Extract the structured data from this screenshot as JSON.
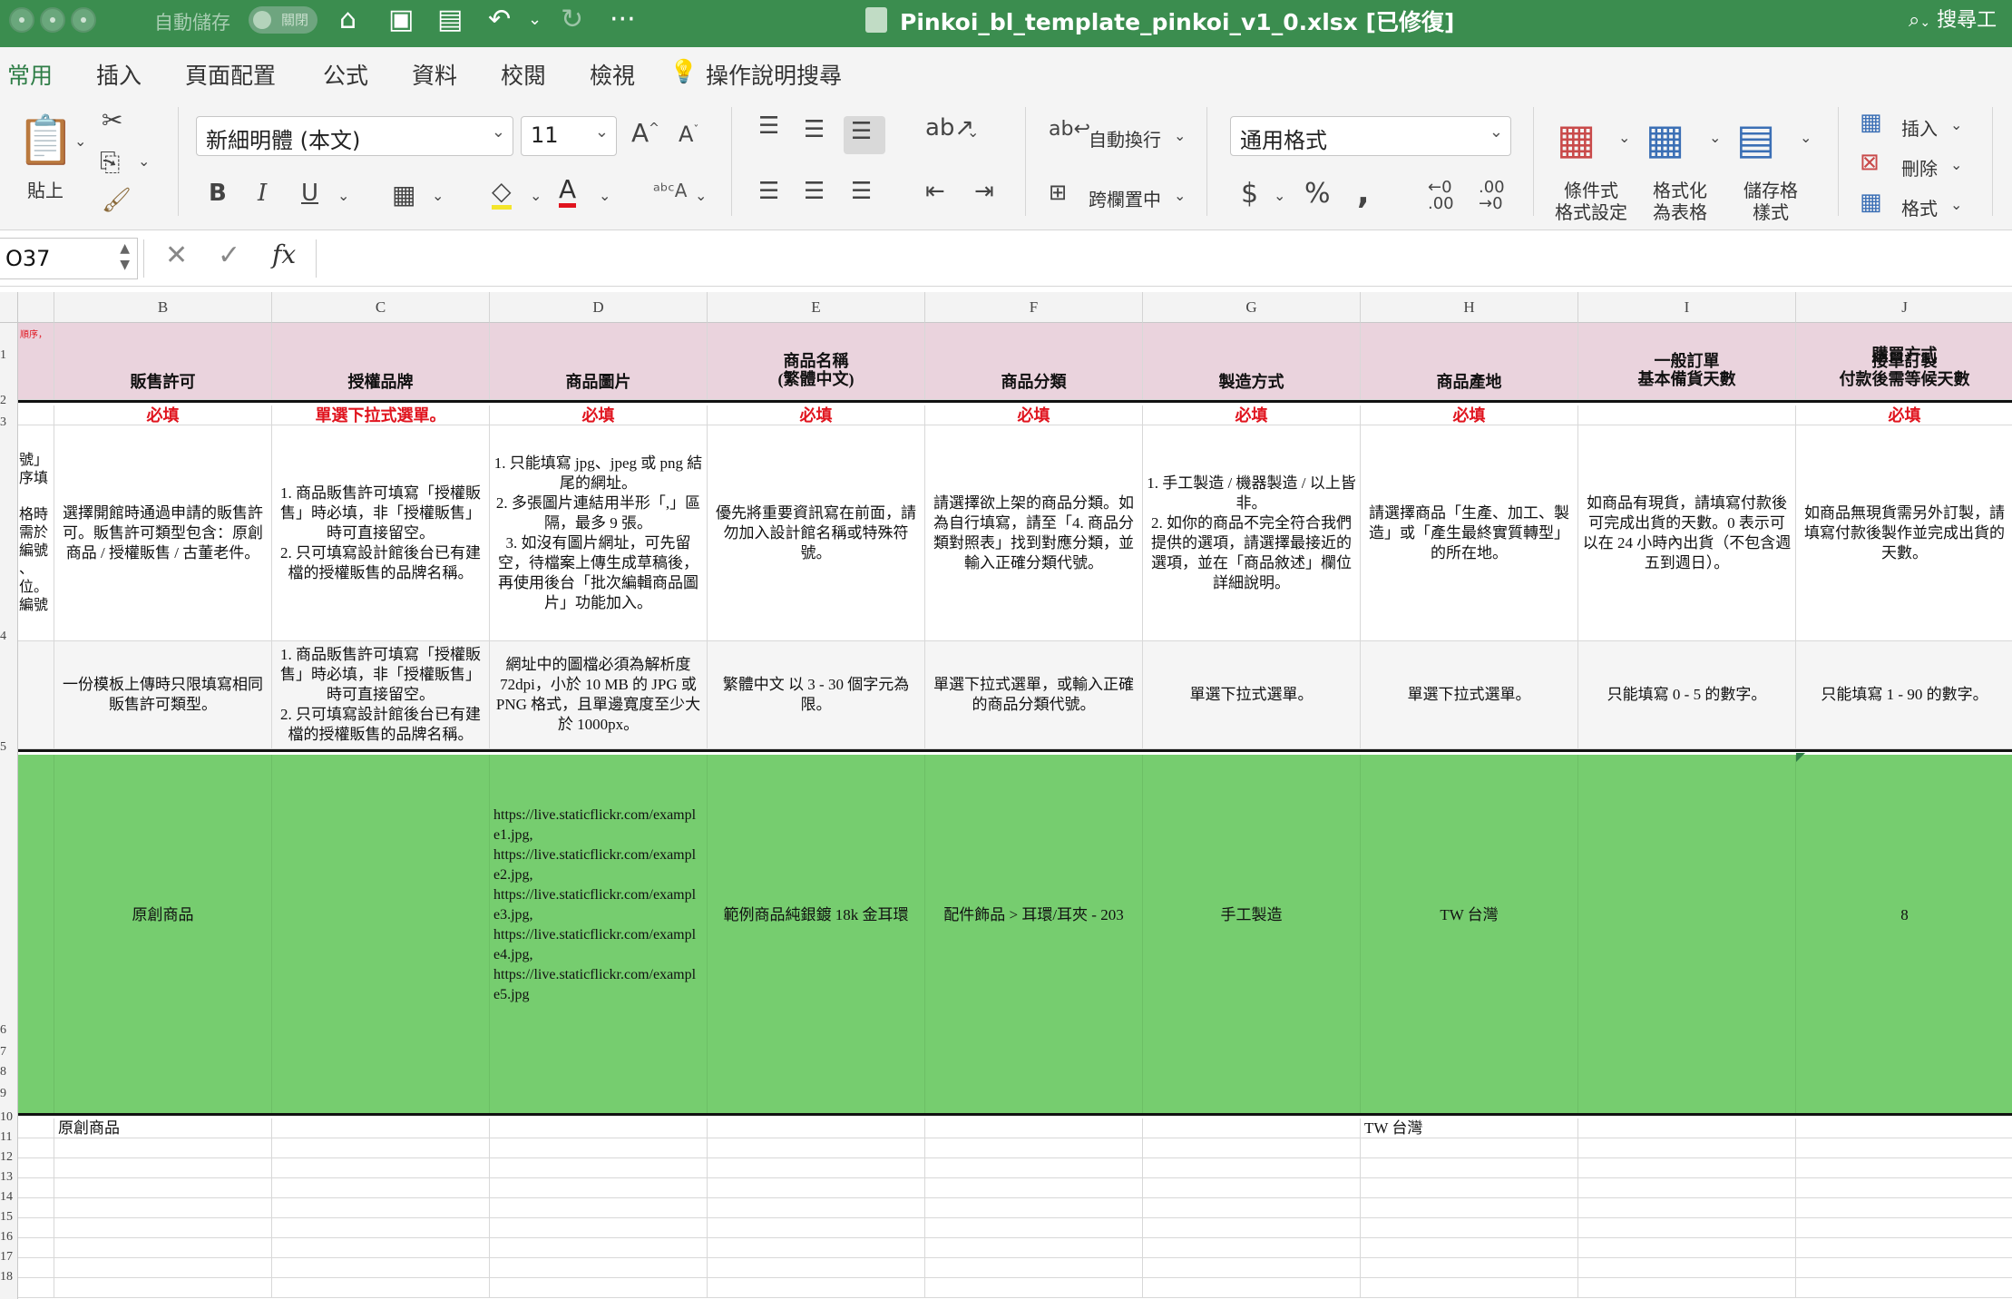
{
  "titlebar": {
    "autosave_label": "自動儲存",
    "autosave_toggle": "關閉",
    "doc_title": "Pinkoi_bl_template_pinkoi_v1_0.xlsx [已修復]",
    "search_label": "搜尋工"
  },
  "ribbon_tabs": [
    "常用",
    "插入",
    "頁面配置",
    "公式",
    "資料",
    "校閱",
    "檢視"
  ],
  "tell_me": "操作說明搜尋",
  "ribbon": {
    "paste": "貼上",
    "font_name": "新細明體 (本文)",
    "font_size": "11",
    "wrap_text": "自動換行",
    "merge_center": "跨欄置中",
    "number_format": "通用格式",
    "cond_format": [
      "條件式",
      "格式設定"
    ],
    "format_table": [
      "格式化",
      "為表格"
    ],
    "cell_styles": [
      "儲存格",
      "樣式"
    ],
    "insert": "插入",
    "delete": "刪除",
    "format": "格式",
    "increase_font": "A",
    "decrease_font": "A"
  },
  "formula_bar": {
    "cell_ref": "O37",
    "fx": "fx",
    "content": ""
  },
  "grid": {
    "columns": [
      "B",
      "C",
      "D",
      "E",
      "F",
      "G",
      "H",
      "I",
      "J"
    ],
    "row_numbers": [
      "1",
      "2",
      "3",
      "4",
      "5",
      "6",
      "7",
      "8",
      "9",
      "10",
      "11",
      "12",
      "13",
      "14",
      "15",
      "16",
      "17",
      "18"
    ],
    "a_col_partial": {
      "row1_hint": "順序，",
      "row4": "號」\n序填\n\n格時\n需於\n編號\n、\n位。\n編號"
    },
    "row1": {
      "J": "購買方式"
    },
    "row2": [
      "販售許可",
      "授權品牌",
      "商品圖片",
      "商品名稱\n(繁體中文)",
      "商品分類",
      "製造方式",
      "商品產地",
      "一般訂單\n基本備貨天數",
      "接單訂製\n付款後需等候天數"
    ],
    "row3": [
      "必填",
      "單選下拉式選單。",
      "必填",
      "必填",
      "必填",
      "必填",
      "必填",
      "",
      "必填"
    ],
    "row4": [
      "選擇開館時通過申請的販售許可。販售許可類型包含：原創商品 / 授權販售 / 古董老件。",
      "1. 商品販售許可填寫「授權販售」時必填，非「授權販售」時可直接留空。\n2. 只可填寫設計館後台已有建檔的授權販售的品牌名稱。",
      "1. 只能填寫 jpg、jpeg 或 png 結尾的網址。\n2. 多張圖片連結用半形「,」區隔，最多 9 張。\n3. 如沒有圖片網址，可先留空，待檔案上傳生成草稿後，再使用後台「批次編輯商品圖片」功能加入。",
      "優先將重要資訊寫在前面，請勿加入設計館名稱或特殊符號。",
      "請選擇欲上架的商品分類。如為自行填寫，請至「4. 商品分類對照表」找到對應分類，並輸入正確分類代號。",
      "1. 手工製造 / 機器製造 / 以上皆非。\n2. 如你的商品不完全符合我們提供的選項，請選擇最接近的選項，並在「商品敘述」欄位詳細說明。",
      "請選擇商品「生產、加工、製造」或「產生最終實質轉型」的所在地。",
      "如商品有現貨，請填寫付款後可完成出貨的天數。0 表示可以在 24 小時內出貨（不包含週五到週日）。",
      "如商品無現貨需另外訂製，請填寫付款後製作並完成出貨的天數。"
    ],
    "row5": [
      "一份模板上傳時只限填寫相同販售許可類型。",
      "1. 商品販售許可填寫「授權販售」時必填，非「授權販售」時可直接留空。\n2. 只可填寫設計館後台已有建檔的授權販售的品牌名稱。",
      "網址中的圖檔必須為解析度 72dpi，小於 10 MB 的 JPG 或 PNG 格式，且單邊寬度至少大於 1000px。",
      "繁體中文 以 3 - 30 個字元為限。",
      "單選下拉式選單，或輸入正確的商品分類代號。",
      "單選下拉式選單。",
      "單選下拉式選單。",
      "只能填寫 0 - 5 的數字。",
      "只能填寫 1 - 90 的數字。"
    ],
    "row6": [
      "原創商品",
      "",
      "https://live.staticflickr.com/exampl\ne1.jpg,\nhttps://live.staticflickr.com/exampl\ne2.jpg,\nhttps://live.staticflickr.com/exampl\ne3.jpg,\nhttps://live.staticflickr.com/exampl\ne4.jpg,\nhttps://live.staticflickr.com/exampl\ne5.jpg",
      "範例商品純銀鍍 18k 金耳環",
      "配件飾品 > 耳環/耳夾 - 203",
      "手工製造",
      "TW 台灣",
      "",
      "8"
    ],
    "row10": {
      "B": "原創商品",
      "H": "TW 台灣"
    },
    "colors": {
      "header_band": "#ead3dd",
      "example_row": "#76cd6f",
      "required_text": "#e0141e",
      "titlebar": "#3b8d4f"
    }
  }
}
